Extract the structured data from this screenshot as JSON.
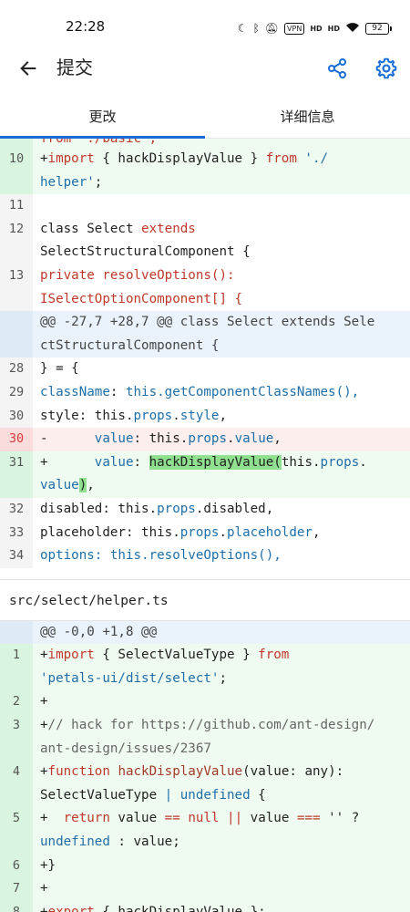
{
  "status_bar": {
    "time": "22:28",
    "vpn": "VPN",
    "signal_1": "HD",
    "signal_2": "HD",
    "battery": "92"
  },
  "app_bar": {
    "title": "提交",
    "back_icon": "arrow-left-icon",
    "share_icon": "share-icon",
    "settings_icon": "gear-icon",
    "accent_color": "#1a6dd6"
  },
  "tabs": [
    {
      "label": "更改",
      "active": true
    },
    {
      "label": "详细信息",
      "active": false
    }
  ],
  "diff": {
    "top_cut_text": "from './basic';",
    "block1": [
      {
        "num": "10",
        "type": "add",
        "lines": [
          [
            {
              "t": "+"
            },
            {
              "t": "import",
              "c": "kw"
            },
            {
              "t": " { hackDisplayValue } "
            },
            {
              "t": "from",
              "c": "kw"
            },
            {
              "t": " './",
              "c": "str"
            }
          ],
          [
            {
              "t": "helper'",
              "c": "str"
            },
            {
              "t": ";"
            }
          ]
        ]
      },
      {
        "num": "11",
        "type": "ctx",
        "lines": [
          [
            {
              "t": ""
            }
          ]
        ]
      },
      {
        "num": "12",
        "type": "ctx",
        "lines": [
          [
            {
              "t": "class Select "
            },
            {
              "t": "extends",
              "c": "kw"
            }
          ],
          [
            {
              "t": "SelectStructuralComponent {"
            }
          ]
        ]
      },
      {
        "num": "13",
        "type": "ctx",
        "lines": [
          [
            {
              "t": "private resolveOptions():",
              "c": "kw"
            }
          ],
          [
            {
              "t": "ISelectOptionComponent[] {",
              "c": "kw"
            }
          ]
        ]
      },
      {
        "num": "",
        "type": "hunk",
        "lines": [
          [
            {
              "t": "@@ -27,7 +28,7 @@ class Select extends Sele"
            }
          ],
          [
            {
              "t": "ctStructuralComponent {"
            }
          ]
        ]
      },
      {
        "num": "28",
        "type": "ctx",
        "lines": [
          [
            {
              "t": "} = {"
            }
          ]
        ]
      },
      {
        "num": "29",
        "type": "ctx",
        "lines": [
          [
            {
              "t": "className",
              "c": "prop"
            },
            {
              "t": ": "
            },
            {
              "t": "this.getComponentClassNames(),",
              "c": "prop"
            }
          ]
        ]
      },
      {
        "num": "30",
        "type": "ctx",
        "lines": [
          [
            {
              "t": "style: this."
            },
            {
              "t": "props",
              "c": "prop"
            },
            {
              "t": "."
            },
            {
              "t": "style",
              "c": "prop"
            },
            {
              "t": ","
            }
          ]
        ]
      },
      {
        "num": "30",
        "type": "del",
        "lines": [
          [
            {
              "t": "-      "
            },
            {
              "t": "value",
              "c": "prop"
            },
            {
              "t": ": this."
            },
            {
              "t": "props",
              "c": "prop"
            },
            {
              "t": "."
            },
            {
              "t": "value",
              "c": "prop"
            },
            {
              "t": ","
            }
          ]
        ]
      },
      {
        "num": "31",
        "type": "add",
        "lines": [
          [
            {
              "t": "+      "
            },
            {
              "t": "value",
              "c": "prop"
            },
            {
              "t": ": "
            },
            {
              "t": "hackDisplayValue(",
              "c": "hl"
            },
            {
              "t": "this."
            },
            {
              "t": "props",
              "c": "prop"
            },
            {
              "t": "."
            }
          ],
          [
            {
              "t": "value",
              "c": "prop"
            },
            {
              "t": ")",
              "c": "hl"
            },
            {
              "t": ","
            }
          ]
        ]
      },
      {
        "num": "32",
        "type": "ctx",
        "lines": [
          [
            {
              "t": "disabled: this."
            },
            {
              "t": "props",
              "c": "prop"
            },
            {
              "t": ".disabled,"
            }
          ]
        ]
      },
      {
        "num": "33",
        "type": "ctx",
        "lines": [
          [
            {
              "t": "placeholder: this."
            },
            {
              "t": "props",
              "c": "prop"
            },
            {
              "t": "."
            },
            {
              "t": "placeholder",
              "c": "prop"
            },
            {
              "t": ","
            }
          ]
        ]
      },
      {
        "num": "34",
        "type": "ctx",
        "lines": [
          [
            {
              "t": "options: this.resolveOptions(),",
              "c": "prop"
            }
          ]
        ]
      }
    ],
    "file2_name": "src/select/helper.ts",
    "block2": [
      {
        "num": "",
        "type": "hunk",
        "lines": [
          [
            {
              "t": "@@ -0,0 +1,8 @@"
            }
          ]
        ]
      },
      {
        "num": "1",
        "type": "add",
        "lines": [
          [
            {
              "t": "+"
            },
            {
              "t": "import",
              "c": "kw"
            },
            {
              "t": " { SelectValueType } "
            },
            {
              "t": "from",
              "c": "kw"
            }
          ],
          [
            {
              "t": "'petals-ui/dist/select'",
              "c": "str"
            },
            {
              "t": ";"
            }
          ]
        ]
      },
      {
        "num": "2",
        "type": "add",
        "lines": [
          [
            {
              "t": "+"
            }
          ]
        ]
      },
      {
        "num": "3",
        "type": "add",
        "lines": [
          [
            {
              "t": "+"
            },
            {
              "t": "// hack for https://github.com/ant-design/",
              "c": "cmt"
            }
          ],
          [
            {
              "t": "ant-design/issues/2367",
              "c": "cmt"
            }
          ]
        ]
      },
      {
        "num": "4",
        "type": "add",
        "lines": [
          [
            {
              "t": "+"
            },
            {
              "t": "function",
              "c": "kw"
            },
            {
              "t": " "
            },
            {
              "t": "hackDisplayValue",
              "c": "fn"
            },
            {
              "t": "(value: any):"
            }
          ],
          [
            {
              "t": "SelectValueType "
            },
            {
              "t": "| undefined",
              "c": "prop"
            },
            {
              "t": " {"
            }
          ]
        ]
      },
      {
        "num": "5",
        "type": "add",
        "lines": [
          [
            {
              "t": "+  "
            },
            {
              "t": "return",
              "c": "kw"
            },
            {
              "t": " value "
            },
            {
              "t": "==",
              "c": "kw"
            },
            {
              "t": " "
            },
            {
              "t": "null",
              "c": "kw"
            },
            {
              "t": " "
            },
            {
              "t": "||",
              "c": "kw"
            },
            {
              "t": " value "
            },
            {
              "t": "===",
              "c": "kw"
            },
            {
              "t": " '' ?"
            }
          ],
          [
            {
              "t": "undefined",
              "c": "prop"
            },
            {
              "t": " : value;"
            }
          ]
        ]
      },
      {
        "num": "6",
        "type": "add",
        "lines": [
          [
            {
              "t": "+}"
            }
          ]
        ]
      },
      {
        "num": "7",
        "type": "add",
        "lines": [
          [
            {
              "t": "+"
            }
          ]
        ]
      },
      {
        "num": "8",
        "type": "add",
        "lines": [
          [
            {
              "t": "+"
            },
            {
              "t": "export",
              "c": "kw"
            },
            {
              "t": " { hackDisplayValue };"
            }
          ]
        ]
      }
    ]
  }
}
